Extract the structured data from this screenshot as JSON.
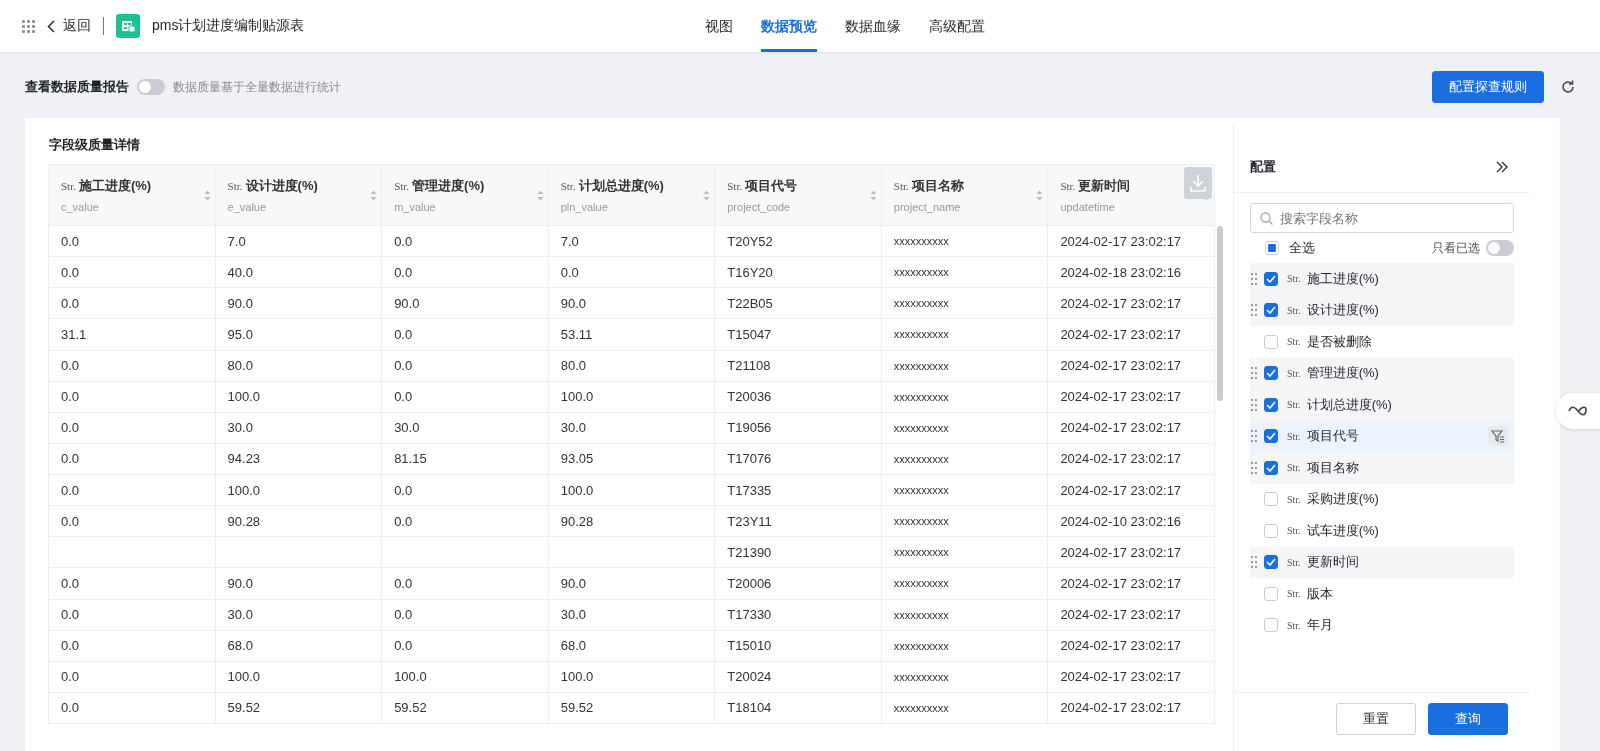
{
  "header": {
    "back": "返回",
    "title": "pms计划进度编制贴源表",
    "tabs": [
      {
        "label": "视图",
        "selected": false
      },
      {
        "label": "数据预览",
        "selected": true
      },
      {
        "label": "数据血缘",
        "selected": false
      },
      {
        "label": "高级配置",
        "selected": false
      }
    ]
  },
  "toolbar": {
    "label": "查看数据质量报告",
    "toggle_on": false,
    "hint": "数据质量基于全量数据进行统计",
    "button": "配置探查规则"
  },
  "card_title": "字段级质量详情",
  "table": {
    "columns": [
      {
        "type": "Str.",
        "title": "施工进度(%)",
        "field": "c_value"
      },
      {
        "type": "Str.",
        "title": "设计进度(%)",
        "field": "e_value"
      },
      {
        "type": "Str.",
        "title": "管理进度(%)",
        "field": "m_value"
      },
      {
        "type": "Str.",
        "title": "计划总进度(%)",
        "field": "pln_value"
      },
      {
        "type": "Str.",
        "title": "项目代号",
        "field": "project_code"
      },
      {
        "type": "Str.",
        "title": "项目名称",
        "field": "project_name"
      },
      {
        "type": "Str.",
        "title": "更新时间",
        "field": "updatetime"
      }
    ],
    "rows": [
      [
        "0.0",
        "7.0",
        "0.0",
        "7.0",
        "T20Y52",
        "xxxxxxxxxx",
        "2024-02-17 23:02:17"
      ],
      [
        "0.0",
        "40.0",
        "0.0",
        "0.0",
        "T16Y20",
        "xxxxxxxxxx",
        "2024-02-18 23:02:16"
      ],
      [
        "0.0",
        "90.0",
        "90.0",
        "90.0",
        "T22B05",
        "xxxxxxxxxx",
        "2024-02-17 23:02:17"
      ],
      [
        "31.1",
        "95.0",
        "0.0",
        "53.11",
        "T15047",
        "xxxxxxxxxx",
        "2024-02-17 23:02:17"
      ],
      [
        "0.0",
        "80.0",
        "0.0",
        "80.0",
        "T21108",
        "xxxxxxxxxx",
        "2024-02-17 23:02:17"
      ],
      [
        "0.0",
        "100.0",
        "0.0",
        "100.0",
        "T20036",
        "xxxxxxxxxx",
        "2024-02-17 23:02:17"
      ],
      [
        "0.0",
        "30.0",
        "30.0",
        "30.0",
        "T19056",
        "xxxxxxxxxx",
        "2024-02-17 23:02:17"
      ],
      [
        "0.0",
        "94.23",
        "81.15",
        "93.05",
        "T17076",
        "xxxxxxxxxx",
        "2024-02-17 23:02:17"
      ],
      [
        "0.0",
        "100.0",
        "0.0",
        "100.0",
        "T17335",
        "xxxxxxxxxx",
        "2024-02-17 23:02:17"
      ],
      [
        "0.0",
        "90.28",
        "0.0",
        "90.28",
        "T23Y11",
        "xxxxxxxxxx",
        "2024-02-10 23:02:16"
      ],
      [
        "",
        "",
        "",
        "",
        "T21390",
        "xxxxxxxxxx",
        "2024-02-17 23:02:17"
      ],
      [
        "0.0",
        "90.0",
        "0.0",
        "90.0",
        "T20006",
        "xxxxxxxxxx",
        "2024-02-17 23:02:17"
      ],
      [
        "0.0",
        "30.0",
        "0.0",
        "30.0",
        "T17330",
        "xxxxxxxxxx",
        "2024-02-17 23:02:17"
      ],
      [
        "0.0",
        "68.0",
        "0.0",
        "68.0",
        "T15010",
        "xxxxxxxxxx",
        "2024-02-17 23:02:17"
      ],
      [
        "0.0",
        "100.0",
        "100.0",
        "100.0",
        "T20024",
        "xxxxxxxxxx",
        "2024-02-17 23:02:17"
      ],
      [
        "0.0",
        "59.52",
        "59.52",
        "59.52",
        "T18104",
        "xxxxxxxxxx",
        "2024-02-17 23:02:17"
      ]
    ]
  },
  "panel": {
    "title": "配置",
    "search": {
      "placeholder": "搜索字段名称"
    },
    "select_all": {
      "label": "全选",
      "indeterminate": true
    },
    "only_selected": {
      "label": "只看已选",
      "on": false
    },
    "fields": [
      {
        "type": "Str.",
        "label": "施工进度(%)",
        "checked": true,
        "hovered": false
      },
      {
        "type": "Str.",
        "label": "设计进度(%)",
        "checked": true,
        "hovered": false
      },
      {
        "type": "Str.",
        "label": "是否被删除",
        "checked": false,
        "hovered": false
      },
      {
        "type": "Str.",
        "label": "管理进度(%)",
        "checked": true,
        "hovered": false
      },
      {
        "type": "Str.",
        "label": "计划总进度(%)",
        "checked": true,
        "hovered": false
      },
      {
        "type": "Str.",
        "label": "项目代号",
        "checked": true,
        "hovered": true
      },
      {
        "type": "Str.",
        "label": "项目名称",
        "checked": true,
        "hovered": false
      },
      {
        "type": "Str.",
        "label": "采购进度(%)",
        "checked": false,
        "hovered": false
      },
      {
        "type": "Str.",
        "label": "试车进度(%)",
        "checked": false,
        "hovered": false
      },
      {
        "type": "Str.",
        "label": "更新时间",
        "checked": true,
        "hovered": false
      },
      {
        "type": "Str.",
        "label": "版本",
        "checked": false,
        "hovered": false
      },
      {
        "type": "Str.",
        "label": "年月",
        "checked": false,
        "hovered": false
      }
    ],
    "buttons": [
      {
        "label": "重置",
        "kind": "secondary"
      },
      {
        "label": "查询",
        "kind": "primary"
      }
    ]
  }
}
